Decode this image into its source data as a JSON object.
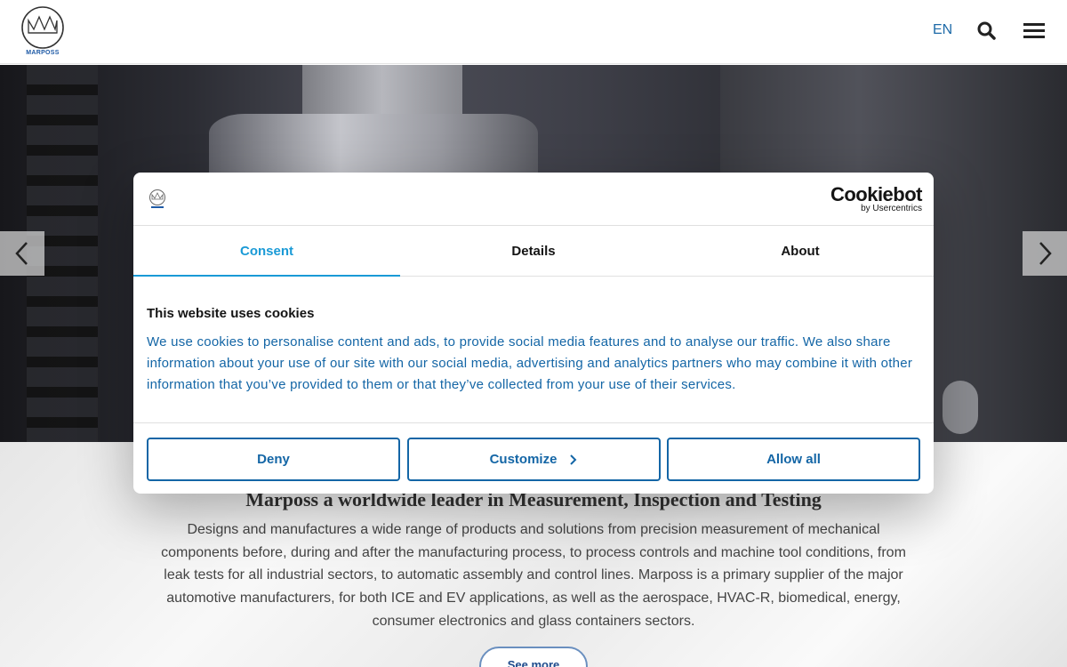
{
  "header": {
    "logo_text": "MARPOSS",
    "language": "EN",
    "icons": {
      "search": "search-icon",
      "menu": "hamburger-menu-icon"
    }
  },
  "hero": {
    "prev_icon": "chevron-left-icon",
    "next_icon": "chevron-right-icon"
  },
  "intro": {
    "title": "Marposs a worldwide leader in Measurement, Inspection and Testing",
    "body": "Designs and manufactures a wide range of products and solutions from precision measurement of mechanical components before, during and after the manufacturing process, to process controls and machine tool conditions, from leak tests for all industrial sectors, to automatic assembly and control lines. Marposs is a primary supplier of the major automotive manufacturers, for both ICE and EV applications, as well as the aerospace, HVAC-R, biomedical, energy, consumer electronics and glass containers sectors.",
    "see_more": "See more"
  },
  "cookie_dialog": {
    "brand_name": "Cookiebot",
    "brand_sub": "by Usercentrics",
    "tabs": [
      {
        "label": "Consent",
        "active": true
      },
      {
        "label": "Details",
        "active": false
      },
      {
        "label": "About",
        "active": false
      }
    ],
    "title": "This website uses cookies",
    "text": "We use cookies to personalise content and ads, to provide social media features and to analyse our traffic. We also share information about your use of our site with our social media, advertising and analytics partners who may combine it with other information that you’ve provided to them or that they’ve collected from your use of their services.",
    "buttons": {
      "deny": "Deny",
      "customize": "Customize",
      "allow_all": "Allow all"
    },
    "colors": {
      "accent": "#1a9ad6",
      "text": "#1466a6"
    }
  }
}
